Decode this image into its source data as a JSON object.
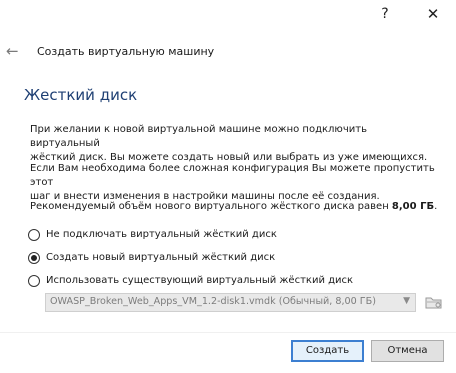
{
  "titlebar": {
    "help_label": "?",
    "close_label": "✕"
  },
  "header": {
    "back_label": "←",
    "title": "Создать виртуальную машину"
  },
  "section": {
    "title": "Жесткий диск"
  },
  "text": {
    "p1_line1": "При желании к новой виртуальной машине можно подключить виртуальный",
    "p1_line2": "жёсткий диск. Вы можете создать новый или выбрать из уже имеющихся.",
    "p2_line1": "Если Вам необходима более сложная конфигурация Вы можете пропустить этот",
    "p2_line2": "шаг и внести изменения в настройки машины после её создания.",
    "p3_prefix": "Рекомендуемый объём нового виртуального жёсткого диска равен ",
    "p3_size": "8,00 ГБ",
    "p3_suffix": "."
  },
  "options": [
    {
      "label": "Не подключать виртуальный жёсткий диск",
      "checked": false
    },
    {
      "label": "Создать новый виртуальный жёсткий диск",
      "checked": true
    },
    {
      "label": "Использовать существующий виртуальный жёсткий диск",
      "checked": false
    }
  ],
  "disk_select": {
    "value": "OWASP_Broken_Web_Apps_VM_1.2-disk1.vmdk (Обычный, 8,00 ГБ)",
    "arrow": "▼"
  },
  "buttons": {
    "create": "Создать",
    "cancel": "Отмена"
  }
}
